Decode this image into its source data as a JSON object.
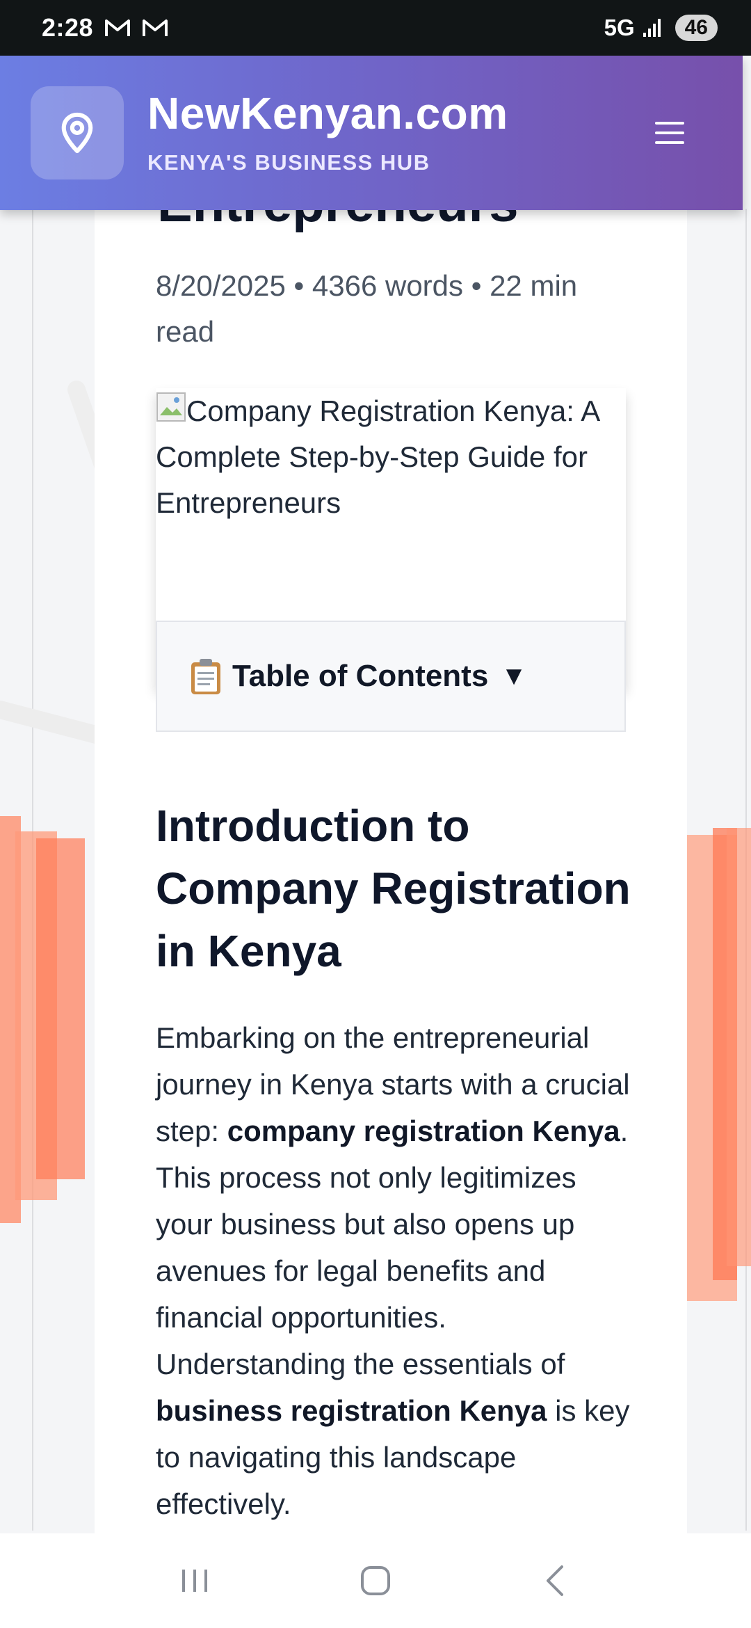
{
  "status_bar": {
    "time": "2:28",
    "network": "5G",
    "battery": "46",
    "notification_icons": [
      "gmail-icon",
      "gmail-icon"
    ]
  },
  "header": {
    "site_name": "NewKenyan.com",
    "tagline": "KENYA'S BUSINESS HUB",
    "logo_icon": "map-pin-icon",
    "menu_icon": "hamburger-menu-icon",
    "gradient_start": "#6c7ee3",
    "gradient_end": "#7750ab"
  },
  "article": {
    "title_visible_fragment": "Entrepreneurs",
    "meta": "8/20/2025 • 4366 words • 22 min read",
    "hero_image_alt": "Company Registration Kenya: A Complete Step-by-Step Guide for Entrepreneurs",
    "toc_label": "Table of Contents",
    "toc_arrow": "▼",
    "section_heading": "Introduction to Company Registration in Kenya",
    "paragraph": {
      "part1": "Embarking on the entrepreneurial journey in Kenya starts with a crucial step: ",
      "bold1": "company registration Kenya",
      "part2": ". This process not only legitimizes your business but also opens up avenues for legal benefits and financial opportunities. Understanding the essentials of ",
      "bold2": "business registration Kenya",
      "part3": " is key to navigating this landscape effectively."
    }
  },
  "nav_bar": {
    "buttons": [
      "recent-apps-icon",
      "home-icon",
      "back-icon"
    ]
  },
  "colors": {
    "status_bar_bg": "#111516",
    "decoration_orange": "#ff7a55",
    "heading_text": "#0f172a"
  }
}
